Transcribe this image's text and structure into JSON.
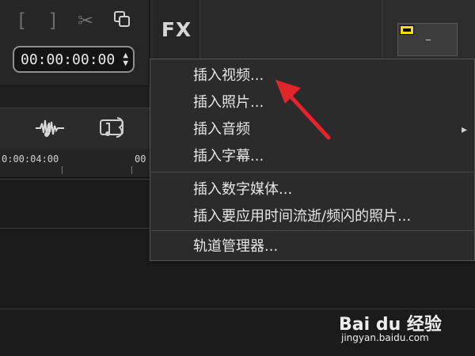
{
  "player": {
    "left_bracket": "[",
    "right_bracket": "]",
    "timecode": "00:00:00:00"
  },
  "effects": {
    "fx_label": "FX"
  },
  "timeline": {
    "ruler_label": "0:00:04:00",
    "ruler_partial": "00"
  },
  "context_menu": {
    "items": [
      {
        "label": "插入视频..."
      },
      {
        "label": "插入照片..."
      },
      {
        "label": "插入音频"
      },
      {
        "label": "插入字幕..."
      },
      {
        "label": "插入数字媒体..."
      },
      {
        "label": "插入要应用时间流逝/频闪的照片..."
      },
      {
        "label": "轨道管理器..."
      }
    ],
    "submenu_arrow": "▸"
  },
  "watermark": {
    "brand": "Bai du 经验",
    "url": "jingyan.baidu.com"
  },
  "colors": {
    "menu_bg": "#2b2b2b",
    "menu_text": "#e6e6e6",
    "annotation_red": "#e1252a",
    "thumb_badge": "#f8e100"
  },
  "icons": {
    "scissors": "scissors-icon",
    "copy": "copy-icon",
    "audio": "audio-waveform-icon",
    "music": "music-track-icon",
    "arrow": "annotation-arrow-icon"
  }
}
